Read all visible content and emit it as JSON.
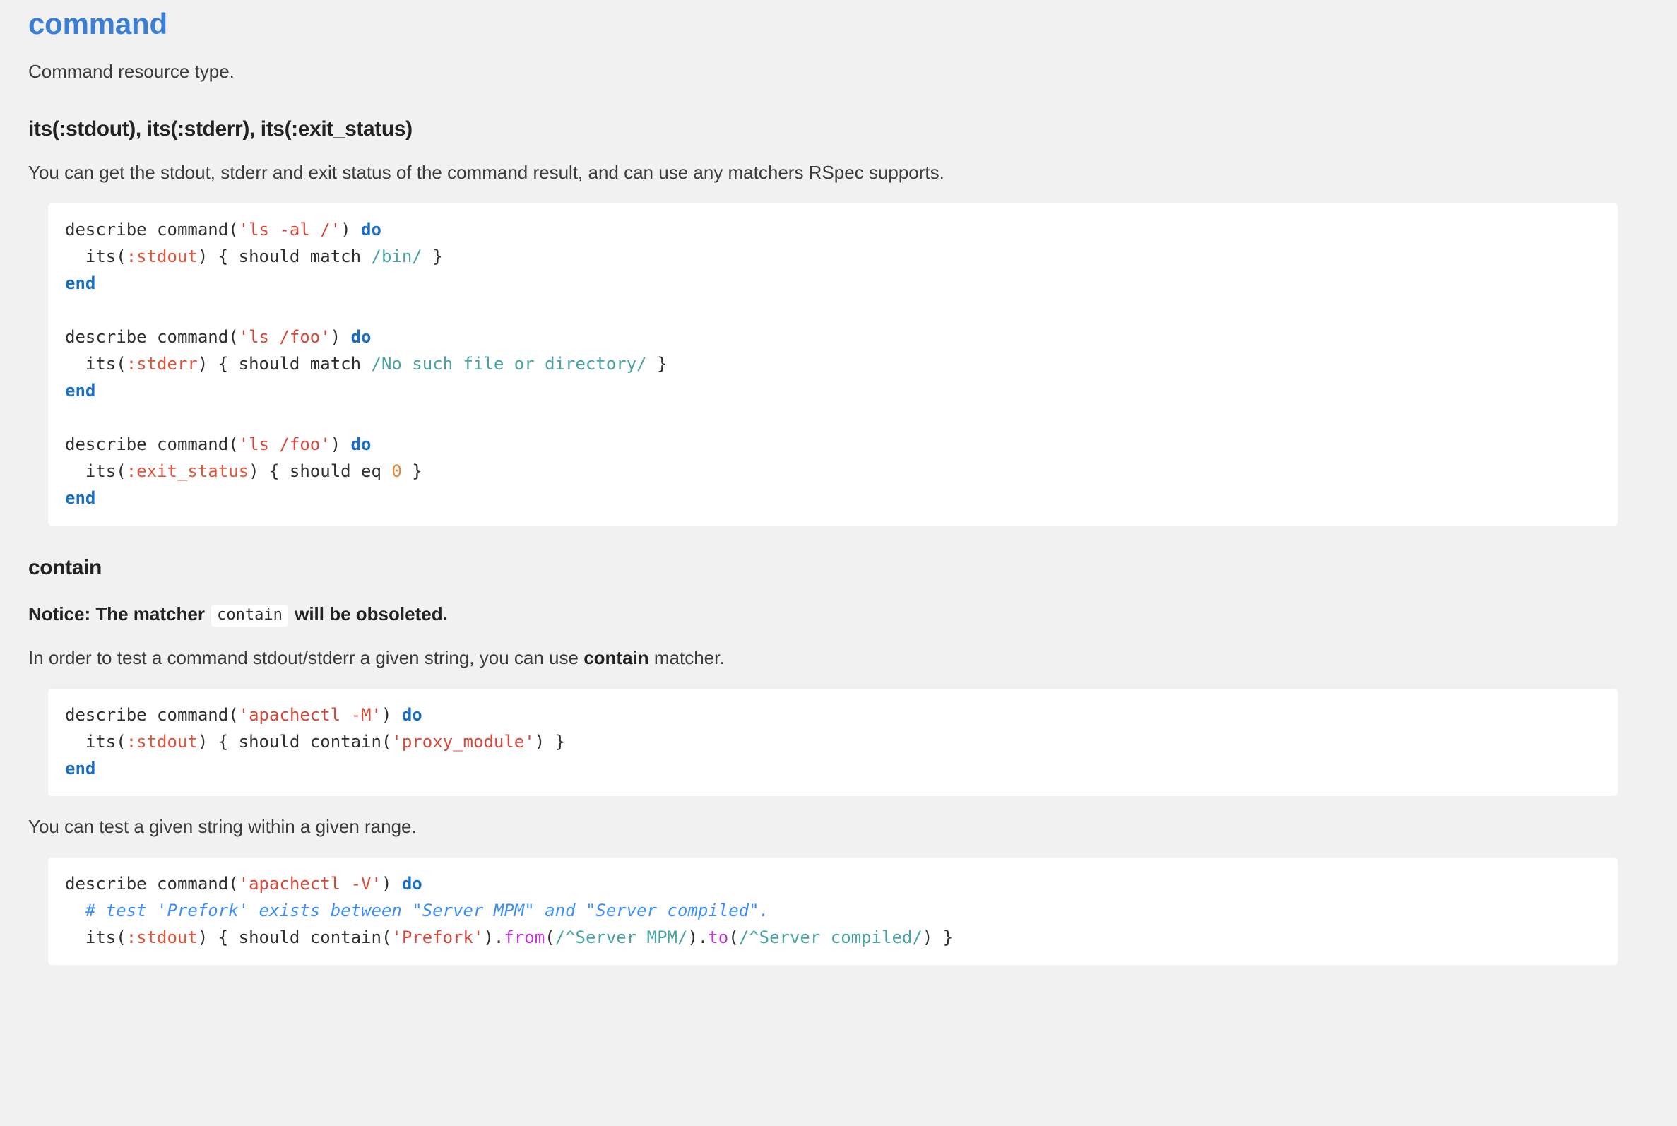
{
  "doc": {
    "title": "command",
    "intro": "Command resource type."
  },
  "sections": [
    {
      "heading": "its(:stdout), its(:stderr), its(:exit_status)",
      "paragraph": "You can get the stdout, stderr and exit status of the command result, and can use any matchers RSpec supports.",
      "code_lines": [
        [
          {
            "t": "describe command(",
            "c": "plain"
          },
          {
            "t": "'ls -al /'",
            "c": "str"
          },
          {
            "t": ") ",
            "c": "plain"
          },
          {
            "t": "do",
            "c": "key"
          }
        ],
        [
          {
            "t": "  its(",
            "c": "plain"
          },
          {
            "t": ":stdout",
            "c": "sym"
          },
          {
            "t": ") { should match ",
            "c": "plain"
          },
          {
            "t": "/bin/",
            "c": "re"
          },
          {
            "t": " }",
            "c": "plain"
          }
        ],
        [
          {
            "t": "end",
            "c": "key"
          }
        ],
        [],
        [
          {
            "t": "describe command(",
            "c": "plain"
          },
          {
            "t": "'ls /foo'",
            "c": "str"
          },
          {
            "t": ") ",
            "c": "plain"
          },
          {
            "t": "do",
            "c": "key"
          }
        ],
        [
          {
            "t": "  its(",
            "c": "plain"
          },
          {
            "t": ":stderr",
            "c": "sym"
          },
          {
            "t": ") { should match ",
            "c": "plain"
          },
          {
            "t": "/No such file or directory/",
            "c": "re"
          },
          {
            "t": " }",
            "c": "plain"
          }
        ],
        [
          {
            "t": "end",
            "c": "key"
          }
        ],
        [],
        [
          {
            "t": "describe command(",
            "c": "plain"
          },
          {
            "t": "'ls /foo'",
            "c": "str"
          },
          {
            "t": ") ",
            "c": "plain"
          },
          {
            "t": "do",
            "c": "key"
          }
        ],
        [
          {
            "t": "  its(",
            "c": "plain"
          },
          {
            "t": ":exit_status",
            "c": "sym"
          },
          {
            "t": ") { should eq ",
            "c": "plain"
          },
          {
            "t": "0",
            "c": "num"
          },
          {
            "t": " }",
            "c": "plain"
          }
        ],
        [
          {
            "t": "end",
            "c": "key"
          }
        ]
      ]
    }
  ],
  "contain_section": {
    "heading": "contain",
    "notice_prefix": "Notice: The matcher ",
    "notice_code": "contain",
    "notice_suffix": " will be obsoleted.",
    "intro_prefix": "In order to test a command stdout/stderr a given string, you can use ",
    "intro_strong": "contain",
    "intro_suffix": " matcher.",
    "code_lines_1": [
      [
        {
          "t": "describe command(",
          "c": "plain"
        },
        {
          "t": "'apachectl -M'",
          "c": "str"
        },
        {
          "t": ") ",
          "c": "plain"
        },
        {
          "t": "do",
          "c": "key"
        }
      ],
      [
        {
          "t": "  its(",
          "c": "plain"
        },
        {
          "t": ":stdout",
          "c": "sym"
        },
        {
          "t": ") { should contain(",
          "c": "plain"
        },
        {
          "t": "'proxy_module'",
          "c": "str"
        },
        {
          "t": ") }",
          "c": "plain"
        }
      ],
      [
        {
          "t": "end",
          "c": "key"
        }
      ]
    ],
    "range_paragraph": "You can test a given string within a given range.",
    "code_lines_2": [
      [
        {
          "t": "describe command(",
          "c": "plain"
        },
        {
          "t": "'apachectl -V'",
          "c": "str"
        },
        {
          "t": ") ",
          "c": "plain"
        },
        {
          "t": "do",
          "c": "key"
        }
      ],
      [
        {
          "t": "  ",
          "c": "plain"
        },
        {
          "t": "# test 'Prefork' exists between \"Server MPM\" and \"Server compiled\".",
          "c": "cmt"
        }
      ],
      [
        {
          "t": "  its(",
          "c": "plain"
        },
        {
          "t": ":stdout",
          "c": "sym"
        },
        {
          "t": ") { should contain(",
          "c": "plain"
        },
        {
          "t": "'Prefork'",
          "c": "str"
        },
        {
          "t": ").",
          "c": "plain"
        },
        {
          "t": "from",
          "c": "meth"
        },
        {
          "t": "(",
          "c": "plain"
        },
        {
          "t": "/^Server MPM/",
          "c": "re"
        },
        {
          "t": ").",
          "c": "plain"
        },
        {
          "t": "to",
          "c": "meth"
        },
        {
          "t": "(",
          "c": "plain"
        },
        {
          "t": "/^Server compiled/",
          "c": "re"
        },
        {
          "t": ") }",
          "c": "plain"
        }
      ]
    ]
  },
  "colors": {
    "page_background": "#f1f1f1",
    "code_background": "#ffffff",
    "title_blue": "#3a7fd5",
    "keyword": "#1a6fc4",
    "string": "#d6483b",
    "symbol": "#e1553c",
    "regex": "#4aa3a3",
    "number": "#e8883a",
    "method": "#c23bd6",
    "comment": "#3d8ef5",
    "body_text": "#3b3b3b"
  }
}
